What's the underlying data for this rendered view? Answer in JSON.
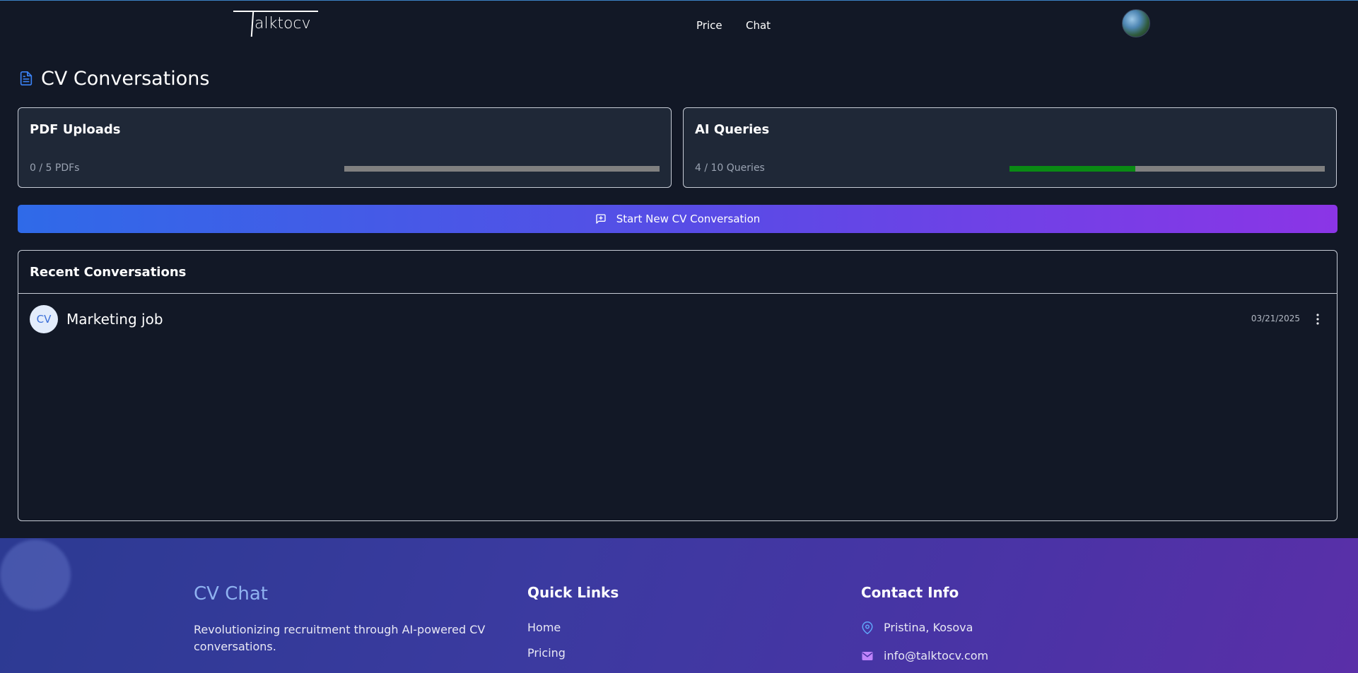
{
  "header": {
    "logo_text": "alktocv",
    "logo_initial": "T",
    "nav": [
      {
        "label": "Price"
      },
      {
        "label": "Chat"
      }
    ]
  },
  "page": {
    "title": "CV Conversations"
  },
  "stats": {
    "pdf": {
      "title": "PDF Uploads",
      "summary": "0 / 5 PDFs",
      "used": 0,
      "limit": 5
    },
    "queries": {
      "title": "AI Queries",
      "summary": "4 / 10 Queries",
      "used": 4,
      "limit": 10
    }
  },
  "cta": {
    "label": "Start New CV Conversation"
  },
  "recent": {
    "heading": "Recent Conversations",
    "items": [
      {
        "avatar": "CV",
        "title": "Marketing job",
        "date": "03/21/2025"
      }
    ]
  },
  "footer": {
    "brand": "CV Chat",
    "description": "Revolutionizing recruitment through AI-powered CV conversations.",
    "quick_links_heading": "Quick Links",
    "links": [
      "Home",
      "Pricing"
    ],
    "contact_heading": "Contact Info",
    "location": "Pristina, Kosova",
    "email": "info@talktocv.com"
  },
  "colors": {
    "background": "#121826",
    "card": "#1f2837",
    "progress_fill": "#0a8a14",
    "progress_track": "#808080",
    "cta_start": "#2f6ae8",
    "cta_end": "#8b35e6"
  },
  "icons": {
    "title": "document-icon",
    "cta": "message-plus-icon",
    "more": "more-vertical-icon",
    "location": "map-pin-icon",
    "email": "mail-icon"
  }
}
